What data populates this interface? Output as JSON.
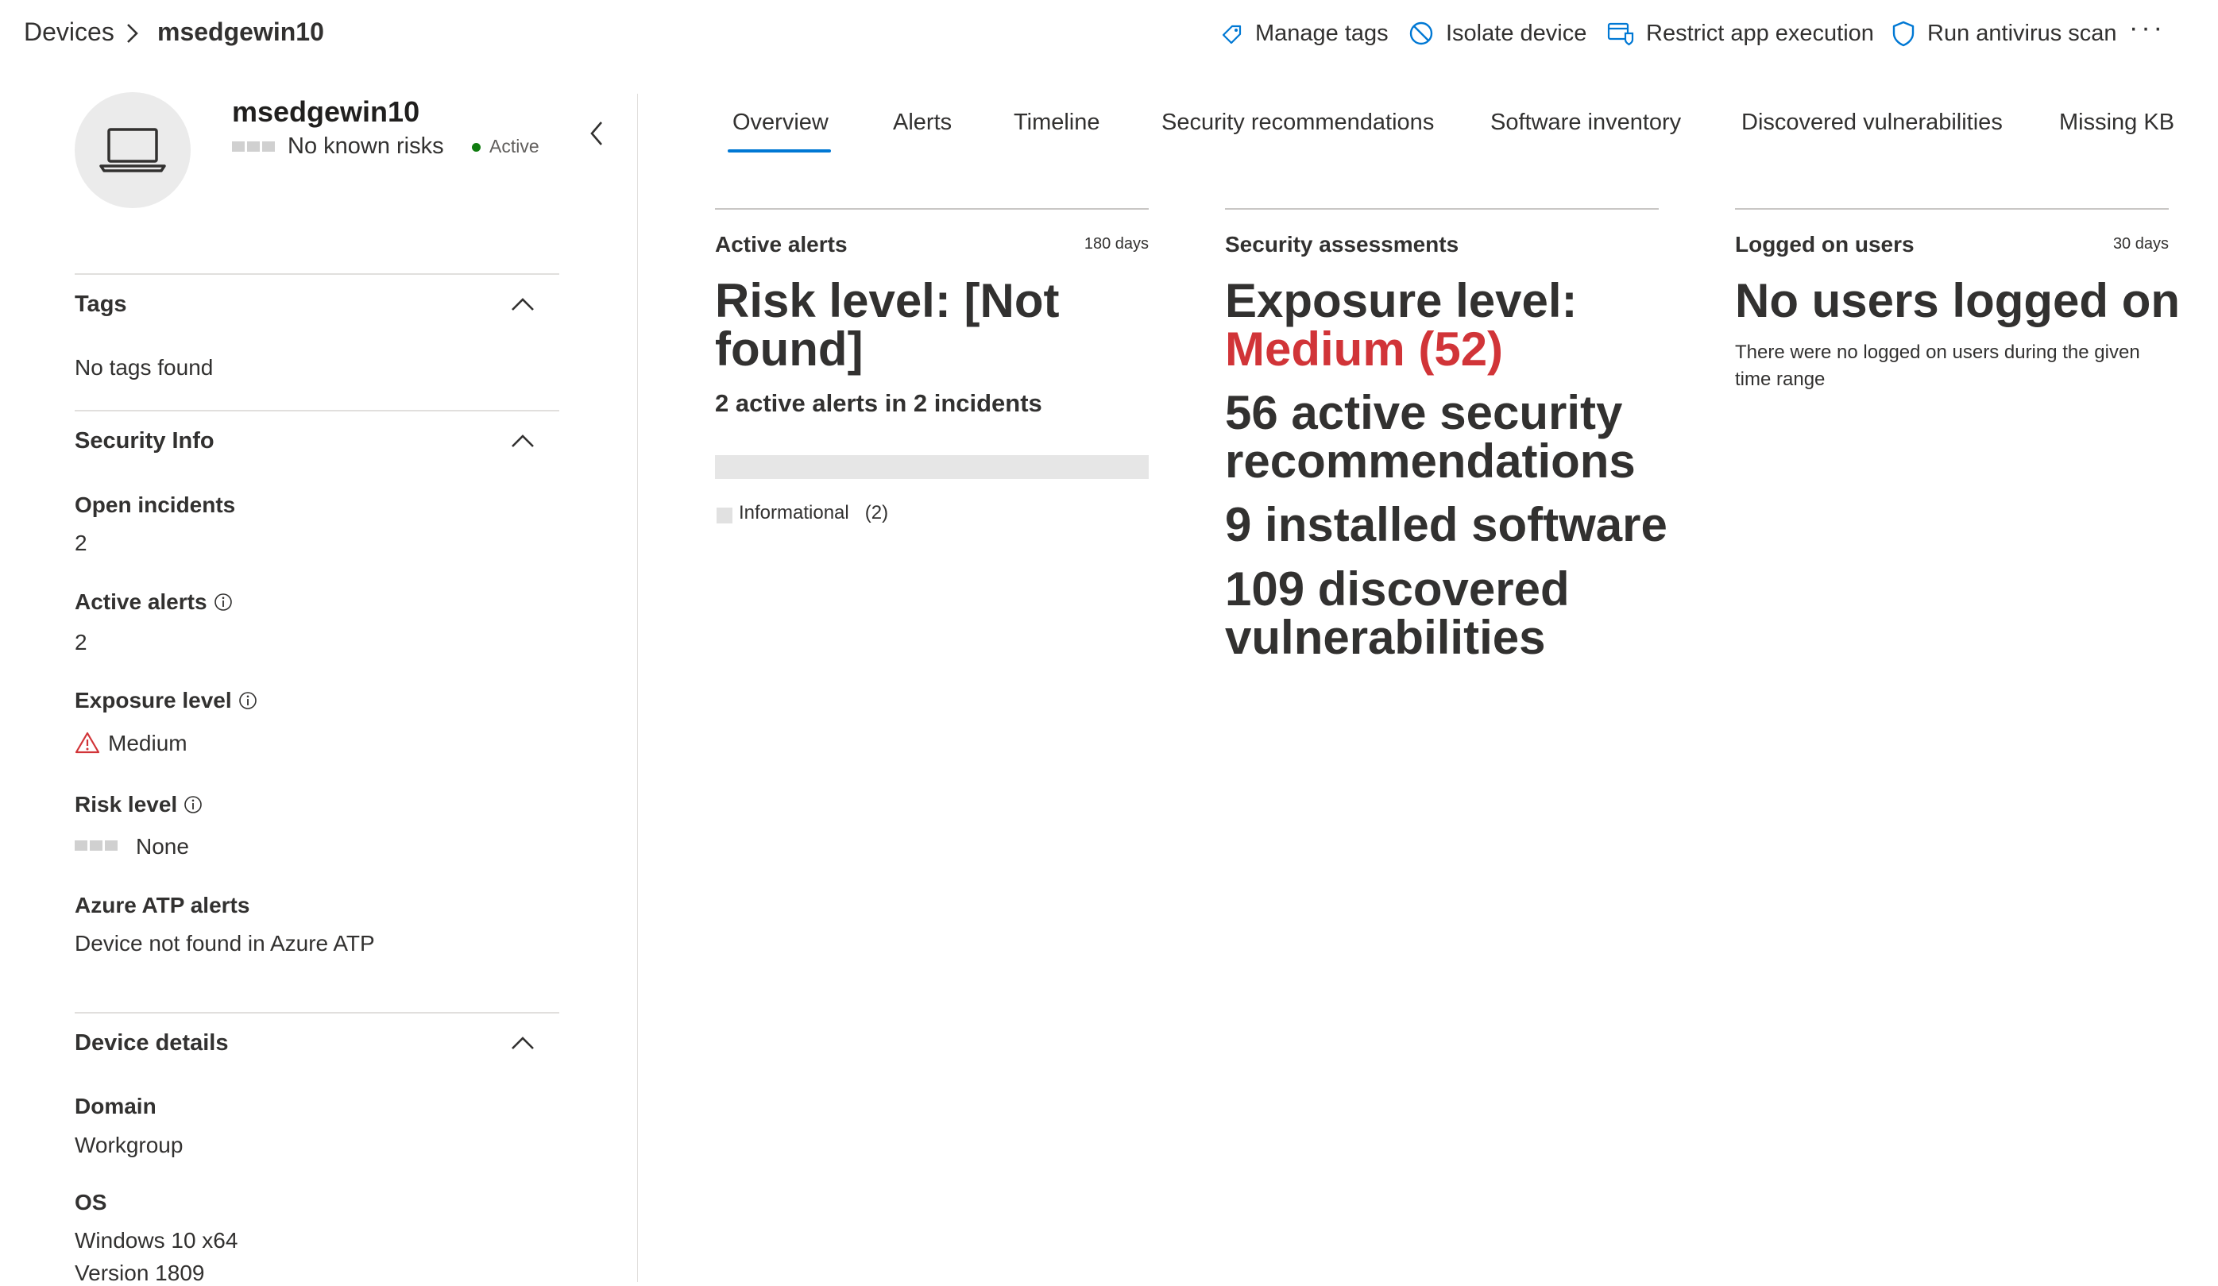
{
  "breadcrumb": {
    "root": "Devices",
    "current": "msedgewin10"
  },
  "actions": {
    "manage_tags": "Manage tags",
    "isolate": "Isolate device",
    "restrict": "Restrict app execution",
    "antivirus": "Run antivirus scan",
    "more": "···"
  },
  "device": {
    "name": "msedgewin10",
    "risk_text": "No known risks",
    "status": "Active"
  },
  "sections": {
    "tags": {
      "title": "Tags",
      "empty": "No tags found"
    },
    "security_info": {
      "title": "Security Info",
      "open_incidents_label": "Open incidents",
      "open_incidents_value": "2",
      "active_alerts_label": "Active alerts",
      "active_alerts_value": "2",
      "exposure_label": "Exposure level",
      "exposure_value": "Medium",
      "risk_label": "Risk level",
      "risk_value": "None",
      "atp_label": "Azure ATP alerts",
      "atp_value": "Device not found in Azure ATP"
    },
    "device_details": {
      "title": "Device details",
      "domain_label": "Domain",
      "domain_value": "Workgroup",
      "os_label": "OS",
      "os_line1": "Windows 10 x64",
      "os_line2": "Version 1809"
    }
  },
  "tabs": [
    "Overview",
    "Alerts",
    "Timeline",
    "Security recommendations",
    "Software inventory",
    "Discovered vulnerabilities",
    "Missing KBs"
  ],
  "cards": {
    "active_alerts": {
      "title": "Active alerts",
      "days": "180 days",
      "risk_line1": "Risk level: [Not",
      "risk_line2": "found]",
      "summary": "2 active alerts in 2 incidents",
      "legend_label": "Informational",
      "legend_count": "(2)"
    },
    "security_assessments": {
      "title": "Security assessments",
      "exposure_prefix": "Exposure level:",
      "exposure_value": "Medium (52)",
      "recs_line1": "56 active security",
      "recs_line2": "recommendations",
      "software": "9 installed software",
      "vulns_line1": "109 discovered",
      "vulns_line2": "vulnerabilities"
    },
    "logged_on_users": {
      "title": "Logged on users",
      "days": "30 days",
      "headline": "No users logged on",
      "note_line1": "There were no logged on users during the given",
      "note_line2": "time range"
    }
  },
  "colors": {
    "accent": "#0078d4",
    "danger": "#d13438",
    "active": "#107c10"
  }
}
